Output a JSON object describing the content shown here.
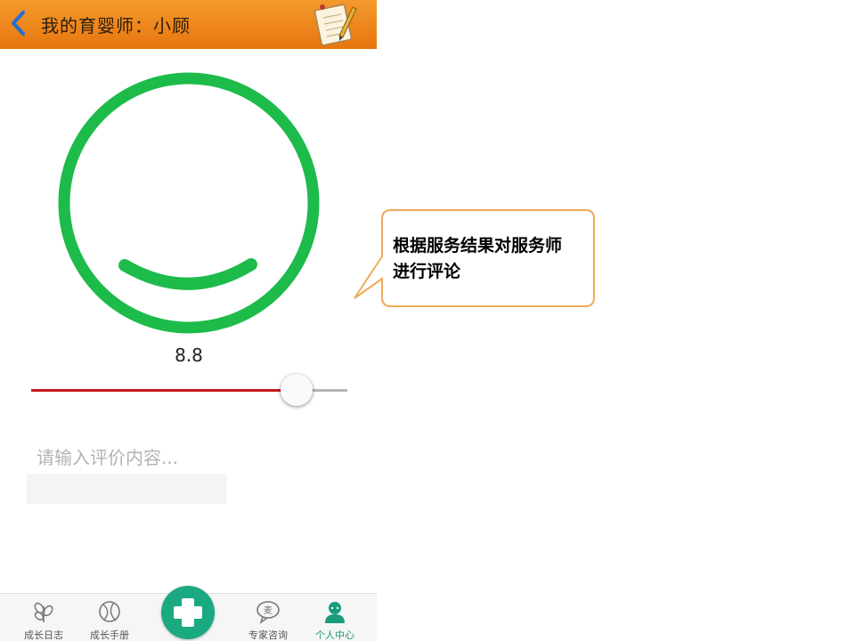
{
  "header": {
    "title": "我的育婴师：小顾",
    "back_icon": "chevron-left-icon",
    "notepad_icon": "notepad-pencil-icon"
  },
  "rating": {
    "face_icon": "smiley-face-icon",
    "face_color": "#1dbb4a",
    "score": "8.8",
    "slider_value_fraction": 0.84,
    "slider_fill_color": "#c8161d"
  },
  "comment": {
    "placeholder": "请输入评价内容..."
  },
  "tabbar": {
    "tabs": [
      {
        "label": "成长日志",
        "icon": "sprout-icon"
      },
      {
        "label": "成长手册",
        "icon": "ball-icon"
      },
      {
        "label": "专家咨询",
        "icon": "chat-bubble-icon"
      },
      {
        "label": "个人中心",
        "icon": "user-icon"
      }
    ],
    "add_icon": "plus-icon",
    "accent_color": "#1ba982"
  },
  "annotation": {
    "text": "根据服务结果对服务师进行评论",
    "border_color": "#f0a95a"
  }
}
